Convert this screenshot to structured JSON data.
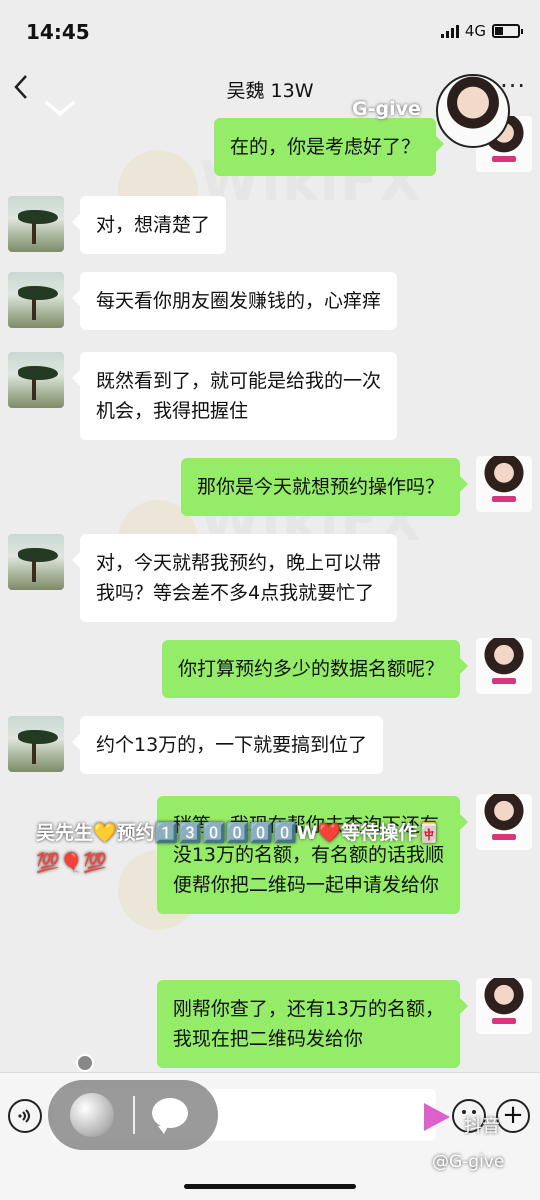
{
  "status": {
    "time": "14:45",
    "network": "4G",
    "battery_level": 0.35
  },
  "nav": {
    "title": "吴魏 13W",
    "more": "···"
  },
  "watermark_overlay": "G-give",
  "messages": [
    {
      "dir": "out",
      "text": "在的，你是考虑好了？"
    },
    {
      "dir": "in",
      "text": "对，想清楚了"
    },
    {
      "dir": "in",
      "text": "每天看你朋友圈发赚钱的，心痒痒"
    },
    {
      "dir": "in",
      "lines": [
        "既然看到了，就可能是给我的一次",
        "机会，我得把握住"
      ]
    },
    {
      "dir": "out",
      "text": "那你是今天就想预约操作吗？"
    },
    {
      "dir": "in",
      "lines": [
        "对，今天就帮我预约，晚上可以带",
        "我吗？等会差不多4点我就要忙了"
      ]
    },
    {
      "dir": "out",
      "text": "你打算预约多少的数据名额呢？"
    },
    {
      "dir": "in",
      "text": "约个13万的，一下就要搞到位了"
    },
    {
      "dir": "out",
      "lines": [
        "稍等，我现在帮你去查询下还有",
        "没13万的名额，有名额的话我顺",
        "便帮你把二维码一起申请发给你"
      ]
    },
    {
      "dir": "out",
      "lines": [
        "刚帮你查了，还有13万的名额，",
        "我现在把二维码发给你"
      ]
    }
  ],
  "banner": {
    "line1": "吴先生💛预约1️⃣3️⃣0️⃣0️⃣0️⃣0️⃣W❤️等待操作🀄",
    "line2": "💯🎈💯"
  },
  "bottom": {
    "overlay_text": "抖音",
    "corner_watermark": "@G-give"
  },
  "wikifx": "WikiFX"
}
